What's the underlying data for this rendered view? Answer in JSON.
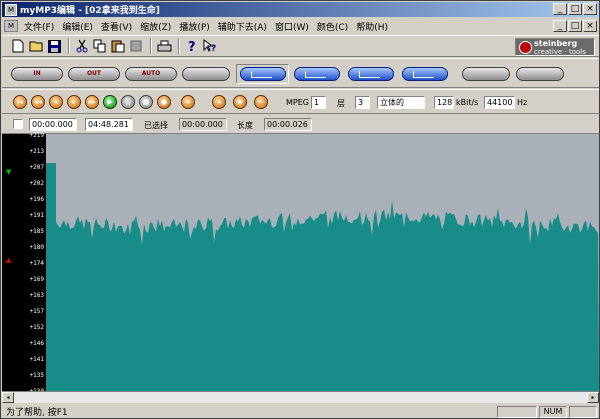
{
  "window": {
    "title": "myMP3编辑 - [02拿来我到生命]",
    "app_icon": "M",
    "minimize": "_",
    "maximize": "□",
    "close": "×"
  },
  "menu": {
    "doc_icon": "M",
    "items": [
      "文件(F)",
      "编辑(E)",
      "查看(V)",
      "缩放(Z)",
      "播放(P)",
      "辅助下去(A)",
      "窗口(W)",
      "颜色(C)",
      "帮助(H)"
    ]
  },
  "toolbar": {
    "brand_name": "steinberg",
    "brand_tag": "creative · tools"
  },
  "effects": {
    "in_label": "IN",
    "out_label": "OUT",
    "auto_label": "AUTO"
  },
  "transport": {
    "mpeg_label": "MPEG",
    "mpeg_value": "1",
    "layer_label": "层",
    "layer_value": "3",
    "mode_value": "立体的",
    "bitrate_value": "128",
    "bitrate_unit": "kBit/s",
    "samplerate_value": "44100",
    "samplerate_unit": "Hz"
  },
  "position": {
    "start": "00:00.000",
    "end": "04:48.281",
    "selected_label": "已选择",
    "selected_value": "00:00.000",
    "length_label": "长度",
    "length_value": "00:00.026"
  },
  "ruler_ticks": [
    "+219",
    "+213",
    "+207",
    "+202",
    "+196",
    "+191",
    "+185",
    "+180",
    "+174",
    "+169",
    "+163",
    "+157",
    "+152",
    "+146",
    "+141",
    "+135",
    "+130"
  ],
  "colors": {
    "waveform": "#188c88",
    "editor_bg": "#aab0b8"
  },
  "status": {
    "message": "为了帮助, 按F1",
    "num": "NUM"
  }
}
